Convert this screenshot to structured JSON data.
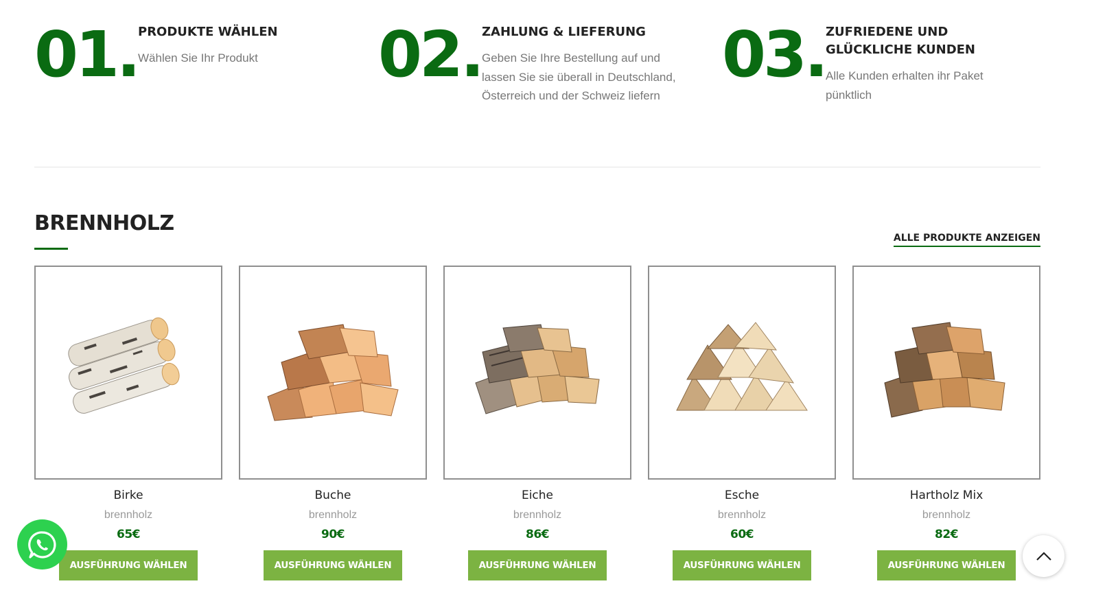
{
  "steps": [
    {
      "number": "01.",
      "title": "PRODUKTE WÄHLEN",
      "text": "Wählen Sie Ihr Produkt"
    },
    {
      "number": "02.",
      "title": "ZAHLUNG & LIEFERUNG",
      "text": "Geben Sie Ihre Bestellung auf und lassen Sie sie überall in Deutschland, Österreich und der Schweiz liefern"
    },
    {
      "number": "03.",
      "title": "ZUFRIEDENE UND GLÜCKLICHE KUNDEN",
      "text": "Alle Kunden erhalten ihr Paket pünktlich"
    }
  ],
  "section": {
    "title": "BRENNHOLZ",
    "all_link": "ALLE PRODUKTE ANZEIGEN"
  },
  "products": [
    {
      "name": "Birke",
      "category": "brennholz",
      "price": "65€",
      "button": "AUSFÜHRUNG WÄHLEN",
      "image_icon": "birch-firewood-image"
    },
    {
      "name": "Buche",
      "category": "brennholz",
      "price": "90€",
      "button": "AUSFÜHRUNG WÄHLEN",
      "image_icon": "beech-firewood-image"
    },
    {
      "name": "Eiche",
      "category": "brennholz",
      "price": "86€",
      "button": "AUSFÜHRUNG WÄHLEN",
      "image_icon": "oak-firewood-image"
    },
    {
      "name": "Esche",
      "category": "brennholz",
      "price": "60€",
      "button": "AUSFÜHRUNG WÄHLEN",
      "image_icon": "ash-firewood-image"
    },
    {
      "name": "Hartholz Mix",
      "category": "brennholz",
      "price": "82€",
      "button": "AUSFÜHRUNG WÄHLEN",
      "image_icon": "hardwood-mix-firewood-image"
    }
  ],
  "colors": {
    "brand_green": "#0a6b12",
    "button_green": "#7cb342",
    "whatsapp_green": "#2dd14f"
  },
  "floating": {
    "whatsapp_icon": "whatsapp-icon",
    "scroll_top_icon": "chevron-up-icon"
  }
}
